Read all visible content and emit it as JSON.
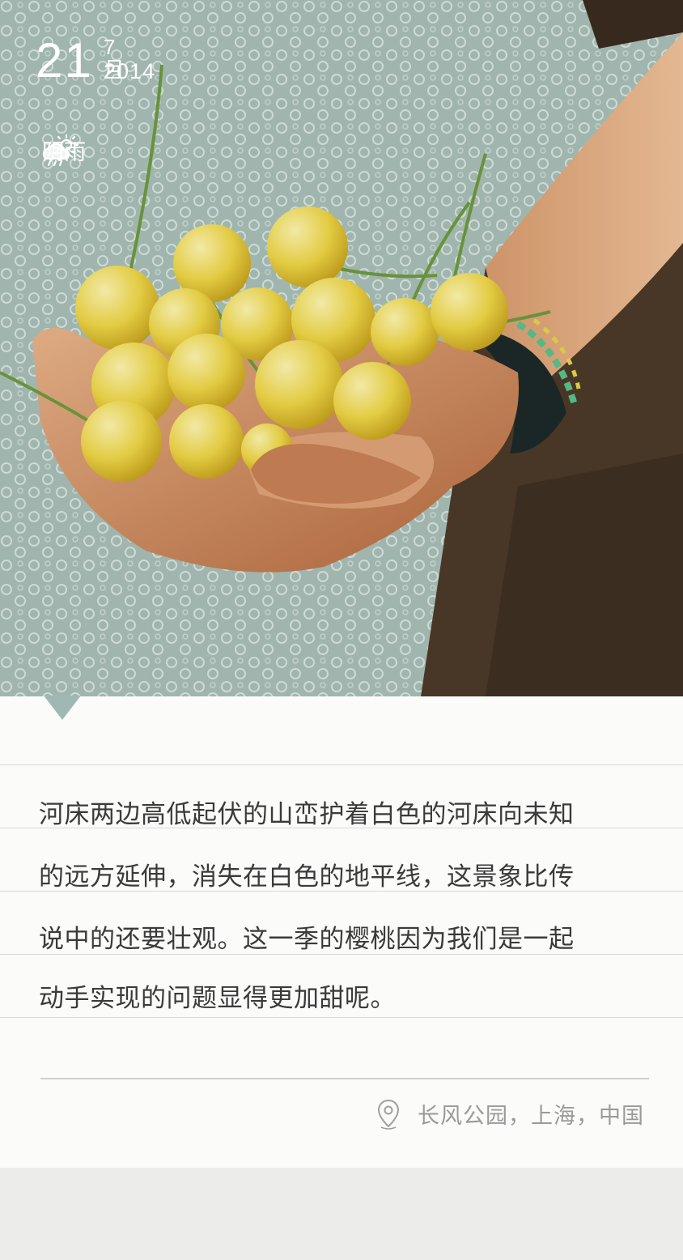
{
  "date": {
    "day": "21",
    "month": "7月",
    "year": "2014"
  },
  "weather": {
    "icon": "cloud-rain-sun-icon",
    "text": "阴雨"
  },
  "photo": {
    "icon": "cherries-in-hand-photo"
  },
  "story": {
    "lines": [
      "河床两边高低起伏的山峦护着白色的河床向未知",
      "的远方延伸，消失在白色的地平线，这景象比传",
      "说中的还要壮观。这一季的樱桃因为我们是一起",
      "动手实现的问题显得更加甜呢。"
    ]
  },
  "location": {
    "icon": "map-pin-icon",
    "text": "长风公园，上海，中国"
  },
  "colors": {
    "card": "#fbfbfa",
    "text": "#3a3a3a",
    "muted": "#9a9a9a",
    "rule": "#d9d9d9"
  }
}
